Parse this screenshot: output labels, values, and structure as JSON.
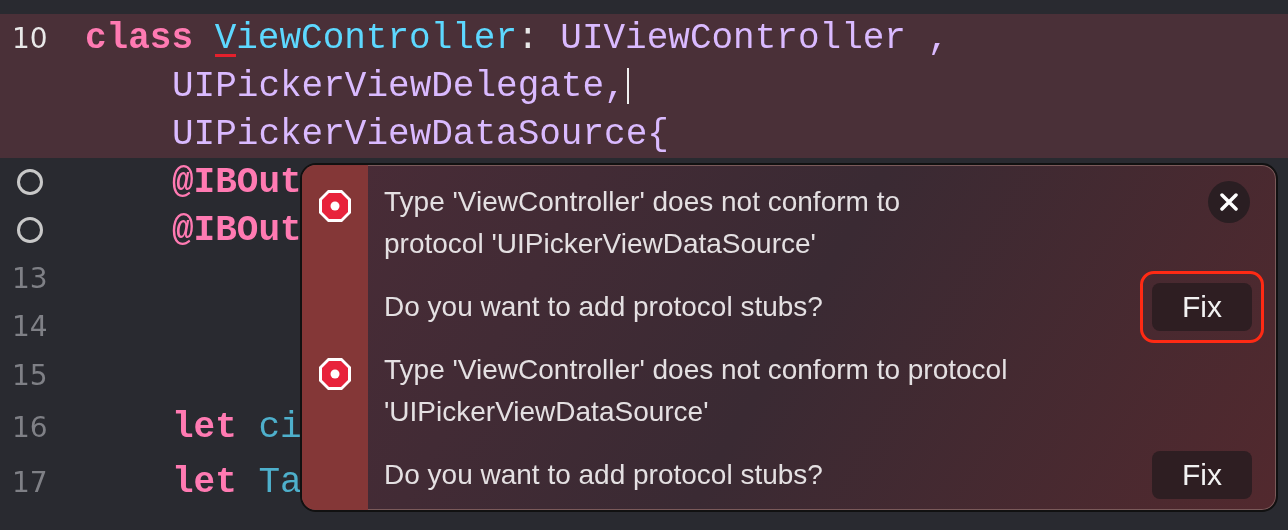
{
  "editor": {
    "lines": [
      {
        "number": "10",
        "kind": "numbered",
        "highlighted": true,
        "tokens": [
          {
            "text": "class",
            "kind": "keyword"
          },
          {
            "text": "ViewController",
            "kind": "type",
            "error_underline": true
          },
          {
            "text": ":",
            "kind": "plain"
          },
          {
            "text": "UIViewController ,",
            "kind": "protocol"
          }
        ]
      },
      {
        "kind": "continuation",
        "highlighted": true,
        "cursor": true,
        "indent": true,
        "tokens": [
          {
            "text": "UIPickerViewDelegate,",
            "kind": "protocol"
          }
        ]
      },
      {
        "kind": "continuation",
        "highlighted": true,
        "indent": true,
        "tokens": [
          {
            "text": "UIPickerViewDataSource{",
            "kind": "protocol"
          }
        ]
      },
      {
        "kind": "outlet",
        "indent": true,
        "tokens": [
          {
            "text": "@IBOut",
            "kind": "keyword"
          }
        ]
      },
      {
        "kind": "outlet",
        "indent": true,
        "tokens": [
          {
            "text": "@IBOut",
            "kind": "keyword"
          }
        ]
      },
      {
        "number": "13",
        "kind": "numbered"
      },
      {
        "number": "14",
        "kind": "numbered"
      },
      {
        "number": "15",
        "kind": "numbered"
      },
      {
        "number": "16",
        "kind": "numbered",
        "indent": true,
        "tokens": [
          {
            "text": "let",
            "kind": "keyword"
          },
          {
            "text": "ci",
            "kind": "name"
          }
        ]
      },
      {
        "number": "17",
        "kind": "numbered",
        "indent": true,
        "tokens": [
          {
            "text": "let",
            "kind": "keyword"
          },
          {
            "text": "Ta",
            "kind": "name"
          }
        ]
      }
    ]
  },
  "issue_popup": {
    "issues": [
      {
        "message": "Type 'ViewController' does not conform to protocol 'UIPickerViewDataSource'",
        "question": "Do you want to add protocol stubs?",
        "fix_button": "Fix",
        "annotated": true
      },
      {
        "message": "Type 'ViewController' does not conform to protocol 'UIPickerViewDataSource'",
        "question": "Do you want to add protocol stubs?",
        "fix_button": "Fix",
        "annotated": false
      }
    ]
  }
}
